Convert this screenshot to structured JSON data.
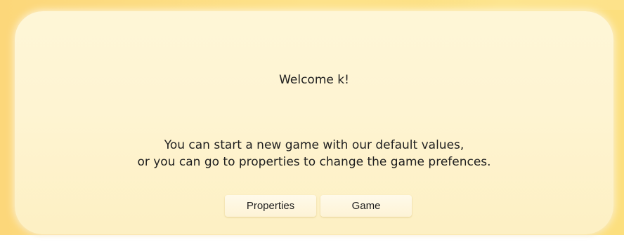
{
  "welcome": {
    "text": "Welcome k!"
  },
  "message": {
    "line1": "You can start a new game with our default values,",
    "line2": "or you can go to properties to change the game prefences."
  },
  "buttons": {
    "properties_label": "Properties",
    "game_label": "Game"
  }
}
